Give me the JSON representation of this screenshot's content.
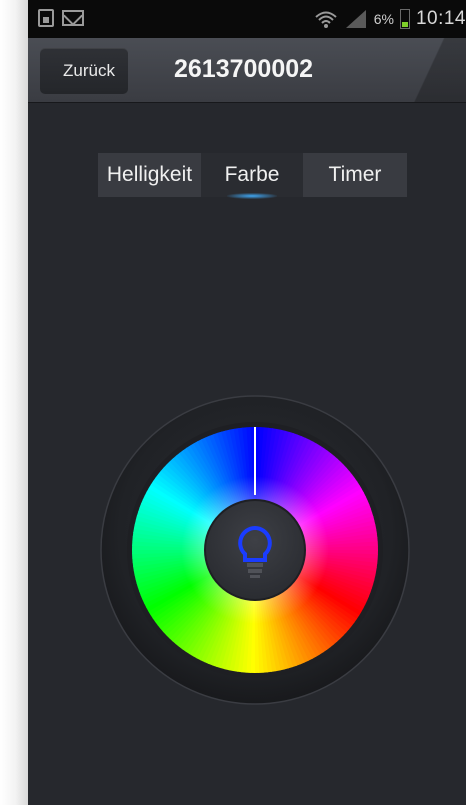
{
  "status_bar": {
    "battery_percent": "6%",
    "time": "10:14"
  },
  "action_bar": {
    "back_label": "Zurück",
    "title": "2613700002"
  },
  "tabs": [
    {
      "label": "Helligkeit",
      "selected": false
    },
    {
      "label": "Farbe",
      "selected": true
    },
    {
      "label": "Timer",
      "selected": false
    }
  ],
  "color_wheel": {
    "selected_hue_deg": 0,
    "center_icon": "lightbulb-icon",
    "center_icon_color": "#1a3cff"
  },
  "colors": {
    "background": "#26282d",
    "accent": "#3fa6f2"
  }
}
